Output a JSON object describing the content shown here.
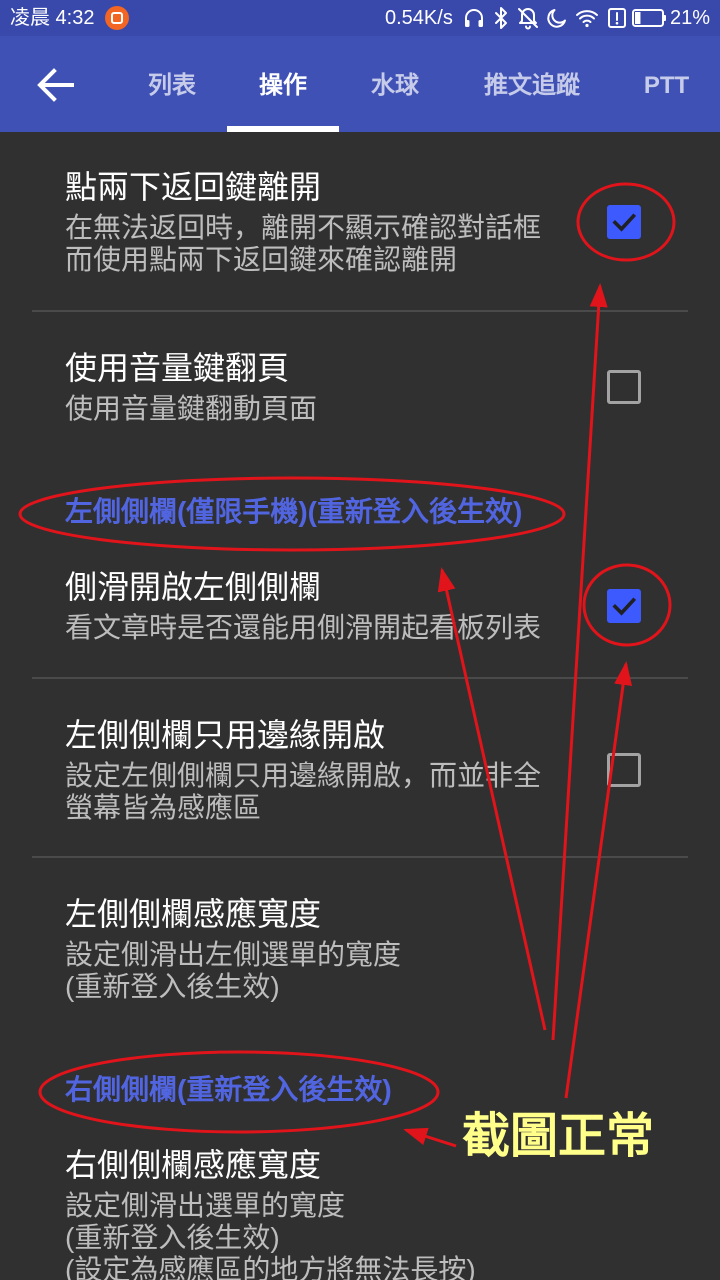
{
  "status_bar": {
    "time": "凌晨 4:32",
    "network_speed": "0.54K/s",
    "battery_percent": "21%",
    "battery_level": 0.21,
    "icons": [
      "app-notification-icon",
      "headphones-icon",
      "bluetooth-icon",
      "notifications-off-icon",
      "moon-icon",
      "wifi-icon",
      "alert-icon",
      "battery-icon"
    ]
  },
  "app_bar": {
    "back_icon": "arrow-back-icon",
    "tabs": [
      {
        "label": "列表",
        "selected": false
      },
      {
        "label": "操作",
        "selected": true
      },
      {
        "label": "水球",
        "selected": false
      },
      {
        "label": "推文追蹤",
        "selected": false
      },
      {
        "label": "PTT",
        "selected": false
      }
    ]
  },
  "settings": {
    "items": [
      {
        "title": "點兩下返回鍵離開",
        "summary": [
          "在無法返回時，離開不顯示確認對話框",
          "而使用點兩下返回鍵來確認離開"
        ],
        "checked": true
      },
      {
        "title": "使用音量鍵翻頁",
        "summary": [
          "使用音量鍵翻動頁面"
        ],
        "checked": false
      },
      {
        "title": "側滑開啟左側側欄",
        "summary": [
          "看文章時是否還能用側滑開起看板列表"
        ],
        "checked": true
      },
      {
        "title": "左側側欄只用邊緣開啟",
        "summary": [
          "設定左側側欄只用邊緣開啟，而並非全",
          "螢幕皆為感應區"
        ],
        "checked": false
      },
      {
        "title": "左側側欄感應寬度",
        "summary": [
          "設定側滑出左側選單的寬度",
          "(重新登入後生效)"
        ]
      },
      {
        "title": "右側側欄感應寬度",
        "summary": [
          "設定側滑出選單的寬度",
          "(重新登入後生效)",
          "(設定為感應區的地方將無法長按)"
        ]
      }
    ],
    "categories": [
      "左側側欄(僅限手機)(重新登入後生效)",
      "右側側欄(重新登入後生效)"
    ],
    "check_icon": "check-icon"
  },
  "annotation": {
    "caption": "截圖正常"
  },
  "colors": {
    "status_bar": "#3949ab",
    "app_bar": "#3f51b5",
    "background": "#303030",
    "accent": "#3d5afe",
    "category_text": "#5165e0",
    "annotation_red": "#e0141a",
    "annotation_caption": "#ffff8a",
    "notification_orange": "#f26522"
  }
}
